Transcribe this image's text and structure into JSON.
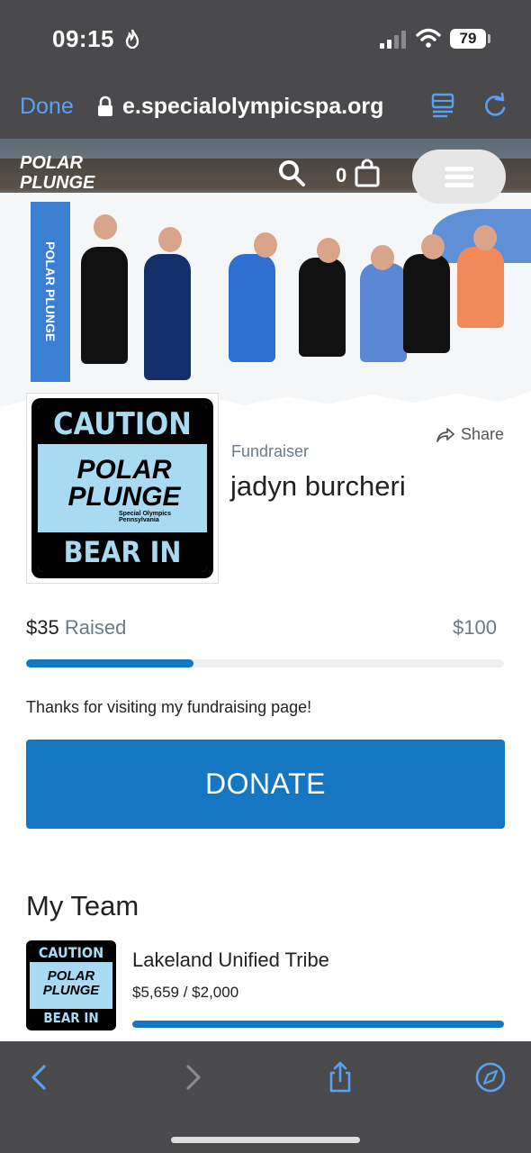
{
  "status_bar": {
    "time": "09:15",
    "battery": "79"
  },
  "browser": {
    "done_label": "Done",
    "url": "e.specialolympicspa.org"
  },
  "hero": {
    "cart_count": "0",
    "logo_text": "POLAR PLUNGE",
    "banner_text": "POLAR PLUNGE"
  },
  "profile": {
    "sign_top": "CAUTION",
    "sign_logo": "POLAR PLUNGE",
    "sign_small": "Special Olympics Pennsylvania",
    "sign_bottom": "BEAR IN AREA",
    "share_label": "Share",
    "role_label": "Fundraiser",
    "name": "jadyn burcheri"
  },
  "fundraising": {
    "raised_amount": "$35",
    "raised_label": "Raised",
    "goal": "$100",
    "progress_fraction": 0.35,
    "message": "Thanks for visiting my fundraising page!"
  },
  "donate_label": "DONATE",
  "team": {
    "heading": "My Team",
    "thumb_top": "CAUTION",
    "thumb_logo": "POLAR PLUNGE",
    "thumb_bottom": "BEAR IN AREA",
    "name": "Lakeland Unified Tribe",
    "amount": "$5,659 / $2,000",
    "progress_fraction": 1.0
  },
  "colors": {
    "accent": "#1577c2",
    "sign_blue": "#a8daf2",
    "browser_chrome": "#4a4a4c",
    "ios_blue": "#5aa0f0"
  },
  "icons": {
    "status": [
      "flame-icon",
      "signal-icon",
      "wifi-icon",
      "battery-icon"
    ],
    "browser": [
      "lock-icon",
      "reader-icon",
      "reload-icon"
    ],
    "hero": [
      "search-icon",
      "cart-icon",
      "menu-icon"
    ],
    "toolbar": [
      "back-icon",
      "forward-icon",
      "share-icon",
      "compass-icon"
    ]
  }
}
